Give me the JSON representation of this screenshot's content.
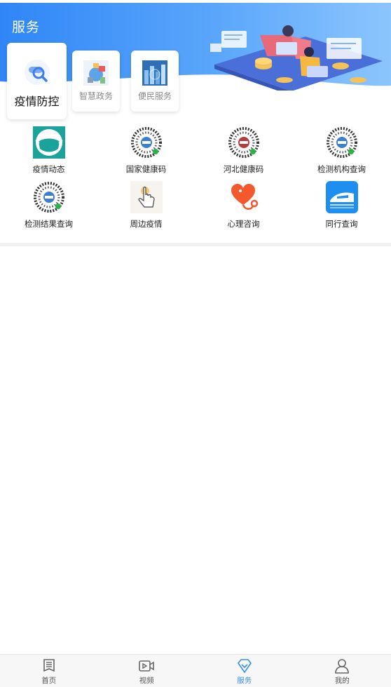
{
  "header": {
    "title": "服务"
  },
  "categories": [
    {
      "label": "疫情防控",
      "icon": "magnifier-icon"
    },
    {
      "label": "智慧政务",
      "icon": "gov-illustration-icon"
    },
    {
      "label": "便民服务",
      "icon": "city-illustration-icon"
    }
  ],
  "services": [
    {
      "label": "疫情动态",
      "icon": "mask-icon"
    },
    {
      "label": "国家健康码",
      "icon": "mini-program-code-icon"
    },
    {
      "label": "河北健康码",
      "icon": "mini-program-code-icon"
    },
    {
      "label": "检测机构查询",
      "icon": "mini-program-code-icon"
    },
    {
      "label": "检测结果查询",
      "icon": "mini-program-code-icon"
    },
    {
      "label": "周边疫情",
      "icon": "hand-pointer-icon"
    },
    {
      "label": "心理咨询",
      "icon": "heart-stethoscope-icon"
    },
    {
      "label": "同行查询",
      "icon": "train-icon"
    }
  ],
  "tabbar": [
    {
      "label": "首页",
      "icon": "document-icon",
      "active": false
    },
    {
      "label": "视频",
      "icon": "video-icon",
      "active": false
    },
    {
      "label": "服务",
      "icon": "diamond-icon",
      "active": true
    },
    {
      "label": "我的",
      "icon": "user-icon",
      "active": false
    }
  ],
  "colors": {
    "accent": "#3a8ee6",
    "header_start": "#2f86f6",
    "header_end": "#8cc5fd"
  }
}
